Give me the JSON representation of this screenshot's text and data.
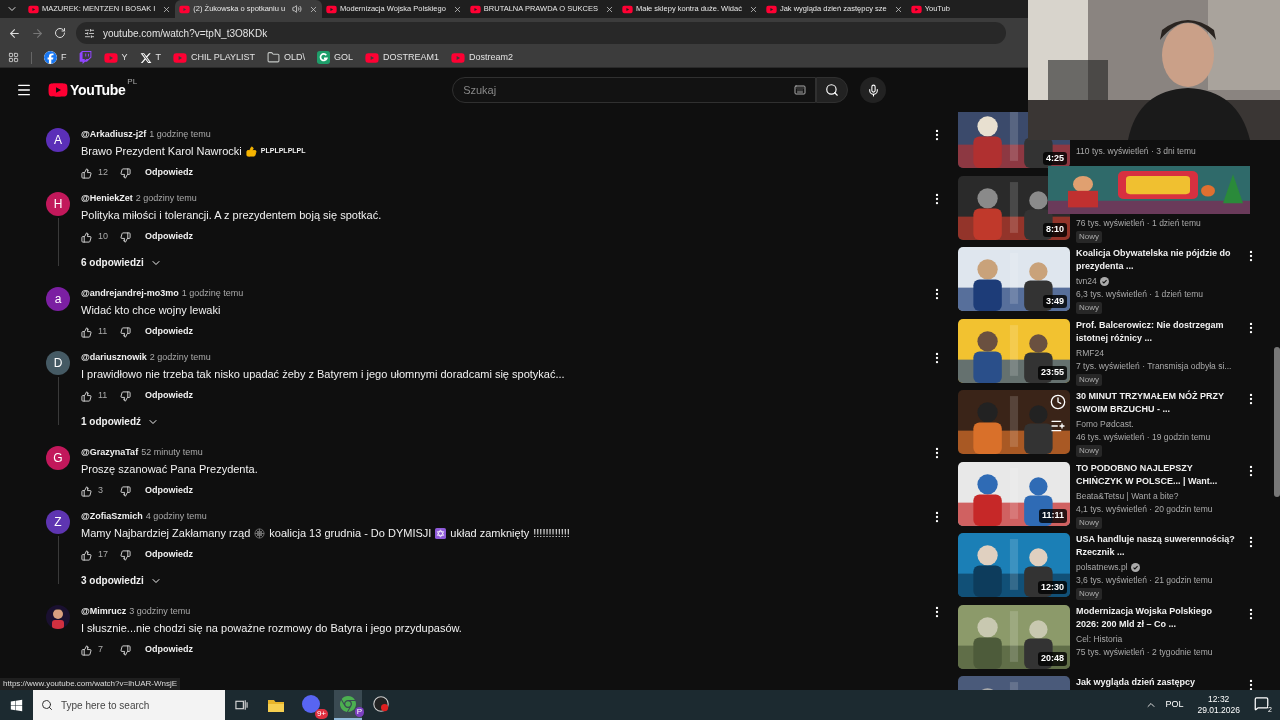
{
  "browser": {
    "tabs": [
      {
        "title": "MAZUREK: MENTZEN I BOSAK I",
        "selected": false,
        "audio": false
      },
      {
        "title": "(2) Żukowska o spotkaniu u",
        "selected": true,
        "audio": true
      },
      {
        "title": "Modernizacja Wojska Polskiego",
        "selected": false,
        "audio": false
      },
      {
        "title": "BRUTALNA PRAWDA O SUKCES",
        "selected": false,
        "audio": false
      },
      {
        "title": "Małe sklepy kontra duże. Widać",
        "selected": false,
        "audio": false
      },
      {
        "title": "Jak wygląda dzień zastępcy sze",
        "selected": false,
        "audio": false
      },
      {
        "title": "YouTub",
        "selected": false,
        "audio": false
      }
    ],
    "url": "youtube.com/watch?v=tpN_t3O8KDk",
    "bookmarks": [
      {
        "kind": "facebook",
        "label": "F"
      },
      {
        "kind": "twitch"
      },
      {
        "kind": "youtube",
        "label": "Y"
      },
      {
        "kind": "x",
        "label": "T"
      },
      {
        "kind": "youtube",
        "label": "CHIL PLAYLIST"
      },
      {
        "kind": "folder",
        "label": "OLD\\"
      },
      {
        "kind": "g",
        "label": "GOL"
      },
      {
        "kind": "youtube",
        "label": "DOSTREAM1"
      },
      {
        "kind": "youtube",
        "label": "Dostream2"
      }
    ]
  },
  "header": {
    "logo": "YouTube",
    "region": "PL",
    "search_placeholder": "Szukaj"
  },
  "comments": [
    {
      "author": "@Arkadiusz-j2f",
      "initial": "A",
      "color": "#5b2fb8",
      "time": "1 godzinę temu",
      "parts": [
        {
          "kind": "text",
          "text": "Brawo Prezydent Karol Nawrocki"
        },
        {
          "kind": "thumb"
        },
        {
          "kind": "small",
          "text": "PLPLPLPLPL"
        }
      ],
      "likes": "12",
      "reply": "Odpowiedz"
    },
    {
      "author": "@HeniekZet",
      "initial": "H",
      "color": "#c2185b",
      "time": "2 godziny temu",
      "parts": [
        {
          "kind": "text",
          "text": "Polityka miłości i tolerancji. A z prezydentem boją się spotkać."
        }
      ],
      "likes": "10",
      "reply": "Odpowiedz",
      "replies": "6 odpowiedzi"
    },
    {
      "author": "@andrejandrej-mo3mo",
      "initial": "a",
      "color": "#7b1fa2",
      "time": "1 godzinę temu",
      "parts": [
        {
          "kind": "text",
          "text": "Widać kto chce wojny lewaki"
        }
      ],
      "likes": "11",
      "reply": "Odpowiedz"
    },
    {
      "author": "@dariusznowik",
      "initial": "D",
      "color": "#455a64",
      "time": "2 godziny temu",
      "parts": [
        {
          "kind": "text",
          "text": "I prawidłowo nie trzeba tak nisko upadać żeby z Batyrem i jego ułomnymi doradcami się spotykać..."
        }
      ],
      "likes": "11",
      "reply": "Odpowiedz",
      "replies": "1 odpowiedź"
    },
    {
      "author": "@GrazynaTaf",
      "initial": "G",
      "color": "#c2185b",
      "time": "52 minuty temu",
      "parts": [
        {
          "kind": "text",
          "text": "Proszę szanować Pana Prezydenta."
        }
      ],
      "likes": "3",
      "reply": "Odpowiedz"
    },
    {
      "author": "@ZofiaSzmich",
      "initial": "Z",
      "color": "#5e35b1",
      "time": "4 godziny temu",
      "parts": [
        {
          "kind": "text",
          "text": "Mamy Najbardziej Zakłamany rząd"
        },
        {
          "kind": "web"
        },
        {
          "kind": "text",
          "text": "koalicja 13 grudnia - Do DYMISJI"
        },
        {
          "kind": "star"
        },
        {
          "kind": "text",
          "text": "układ zamknięty"
        },
        {
          "kind": "text",
          "text": "!!!!!!!!!!!!"
        }
      ],
      "likes": "17",
      "reply": "Odpowiedz",
      "replies": "3 odpowiedzi"
    },
    {
      "author": "@Mimrucz",
      "kind": "picture",
      "time": "3 godziny temu",
      "parts": [
        {
          "kind": "text",
          "text": "I słusznie...nie chodzi się na poważne rozmowy do Batyra i jego przydupasów."
        }
      ],
      "likes": "7",
      "reply": "Odpowiedz"
    }
  ],
  "related": [
    {
      "kind": "video",
      "duration": "4:25",
      "meta": "110 tys. wyświetleń · 3 dni temu"
    },
    {
      "kind": "video",
      "duration": "8:10",
      "meta": "76 tys. wyświetleń · 1 dzień temu",
      "badge": "Nowy"
    },
    {
      "kind": "video",
      "duration": "3:49",
      "title": "Koalicja Obywatelska nie pójdzie do prezydenta ...",
      "channel": "tvn24",
      "verified": true,
      "meta": "6,3 tys. wyświetleń · 1 dzień temu",
      "badge": "Nowy"
    },
    {
      "kind": "video",
      "duration": "23:55",
      "title": "Prof. Balcerowicz: Nie dostrzegam istotnej różnicy ...",
      "channel": "RMF24",
      "verified": false,
      "meta": "7 tys. wyświetleń · Transmisja odbyła si...",
      "badge": "Nowy"
    },
    {
      "kind": "hover",
      "title": "30 MINUT TRZYMAŁEM NÓŻ PRZY SWOIM BRZUCHU - ...",
      "channel": "Fomo Pødcast.",
      "verified": false,
      "meta": "46 tys. wyświetleń · 19 godzin temu",
      "badge": "Nowy"
    },
    {
      "kind": "video",
      "duration": "11:11",
      "title": "TO PODOBNO NAJLEPSZY CHIŃCZYK W POLSCE... | Want...",
      "channel": "Beata&Tetsu | Want a bite?",
      "verified": false,
      "meta": "4,1 tys. wyświetleń · 20 godzin temu",
      "badge": "Nowy"
    },
    {
      "kind": "video",
      "duration": "12:30",
      "title": "USA handluje naszą suwerennością? Rzecznik ...",
      "channel": "polsatnews.pl",
      "verified": true,
      "meta": "3,6 tys. wyświetleń · 21 godzin temu",
      "badge": "Nowy"
    },
    {
      "kind": "video",
      "duration": "20:48",
      "title": "Modernizacja Wojska Polskiego 2026: 200 Mld zł – Co ...",
      "channel": "Cel: Historia",
      "verified": false,
      "meta": "75 tys. wyświetleń · 2 tygodnie temu"
    },
    {
      "kind": "video",
      "title": "Jak wygląda dzień zastępcy"
    }
  ],
  "status_url": "https://www.youtube.com/watch?v=lhUAR-WnsjE",
  "taskbar": {
    "search_placeholder": "Type here to search",
    "chat_badge": "9+",
    "chrome_badge": "P",
    "lang": "POL",
    "time": "12:32",
    "date": "29.01.2026",
    "notifications": "2"
  }
}
